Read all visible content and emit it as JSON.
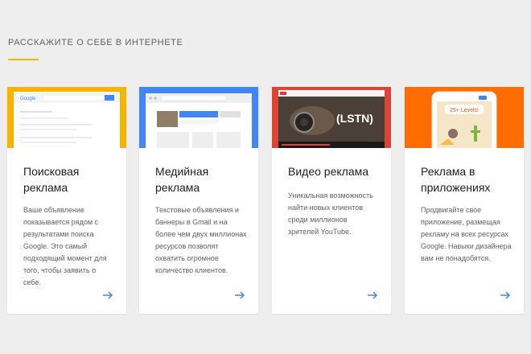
{
  "section": {
    "title": "РАССКАЖИТЕ О СЕБЕ В ИНТЕРНЕТЕ"
  },
  "colors": {
    "accent_yellow": "#f4b400",
    "accent_blue": "#4285f4",
    "accent_red": "#db4437",
    "accent_orange": "#ff6d00",
    "arrow": "#4285f4"
  },
  "cards": [
    {
      "title": "Поисковая реклама",
      "description": "Ваше объявление показывается рядом с результатами поиска Google. Это самый подходящий момент для того, чтобы заявить о себе.",
      "banner_logo": "Google",
      "arrow_icon": "arrow-right-icon"
    },
    {
      "title": "Медийная реклама",
      "description": "Текстовые объявления и баннеры в Gmail и на более чем двух миллионах ресурсов позволят охватить огромное количество клиентов.",
      "arrow_icon": "arrow-right-icon"
    },
    {
      "title": "Видео реклама",
      "description": "Уникальная возможность найти новых клиентов среди миллионов зрителей YouTube.",
      "banner_video_text": "(LSTN)",
      "arrow_icon": "arrow-right-icon"
    },
    {
      "title": "Реклама в приложениях",
      "description": "Продвигайте свое приложение, размещая рекламу на всех ресурсах Google. Навыки дизайнера вам не понадобятся.",
      "banner_game_text": "25+ Levels!",
      "arrow_icon": "arrow-right-icon"
    }
  ]
}
